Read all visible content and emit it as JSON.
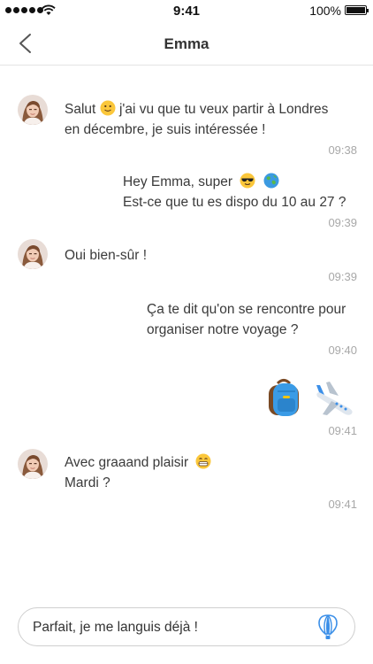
{
  "status_bar": {
    "time": "9:41",
    "battery": "100%",
    "battery_level": 1.0
  },
  "header": {
    "title": "Emma"
  },
  "messages": [
    {
      "from": "Emma",
      "line1_a": "Salut",
      "line1_b": "j'ai vu que tu veux partir à Londres",
      "line2": "en décembre, je suis intéressée !",
      "time": "09:38",
      "emojis": [
        "slightly-smiling-face"
      ]
    },
    {
      "from": "me",
      "line1": "Hey Emma, super",
      "line2": "Est-ce que tu es dispo du 10 au 27 ?",
      "time": "09:39",
      "emojis": [
        "sunglasses-face",
        "globe"
      ]
    },
    {
      "from": "Emma",
      "line1": "Oui bien-sûr !",
      "time": "09:39"
    },
    {
      "from": "me",
      "line1": "Ça te dit qu'on se rencontre pour",
      "line2": "organiser notre voyage ?",
      "time": "09:40"
    },
    {
      "from": "me",
      "stickers": [
        "backpack",
        "airplane"
      ],
      "time": "09:41"
    },
    {
      "from": "Emma",
      "line1": "Avec graaand plaisir",
      "line2": "Mardi ?",
      "time": "09:41",
      "emojis": [
        "grinning-face"
      ]
    }
  ],
  "composer": {
    "value": "Parfait, je me languis déjà !"
  },
  "colors": {
    "accent_blue": "#3b8fe8",
    "time_gray": "#a8a8a8",
    "divider": "#e4e4e4"
  }
}
